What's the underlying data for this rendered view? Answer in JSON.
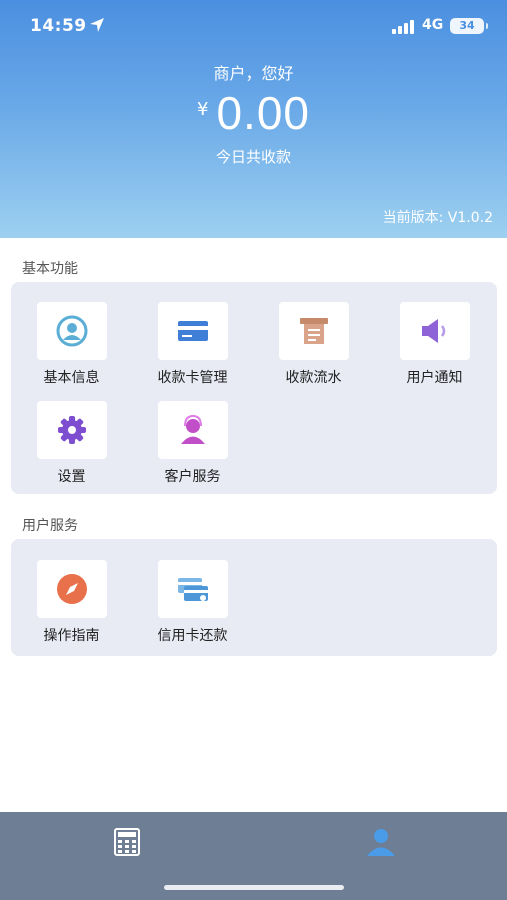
{
  "status": {
    "time": "14:59",
    "network": "4G",
    "battery": "34"
  },
  "header": {
    "greeting": "商户，您好",
    "currency": "¥",
    "amount": "0.00",
    "amount_caption": "今日共收款",
    "version": "当前版本: V1.0.2"
  },
  "basic": {
    "title": "基本功能",
    "items": [
      {
        "label": "基本信息",
        "icon": "user-info-icon"
      },
      {
        "label": "收款卡管理",
        "icon": "card-icon"
      },
      {
        "label": "收款流水",
        "icon": "receipt-icon"
      },
      {
        "label": "用户通知",
        "icon": "speaker-icon"
      },
      {
        "label": "设置",
        "icon": "gear-icon"
      },
      {
        "label": "客户服务",
        "icon": "customer-service-icon"
      }
    ]
  },
  "service": {
    "title": "用户服务",
    "items": [
      {
        "label": "操作指南",
        "icon": "compass-icon"
      },
      {
        "label": "信用卡还款",
        "icon": "credit-card-repay-icon"
      }
    ]
  },
  "tabs": [
    {
      "icon": "calculator-icon",
      "active": false
    },
    {
      "icon": "profile-icon",
      "active": true
    }
  ],
  "colors": {
    "header_top": "#4a8fe0",
    "header_bottom": "#9dd0f0",
    "panel_bg": "#e8eaf4",
    "tabbar_bg": "#6e7f95",
    "active_tab": "#4a9be8"
  }
}
